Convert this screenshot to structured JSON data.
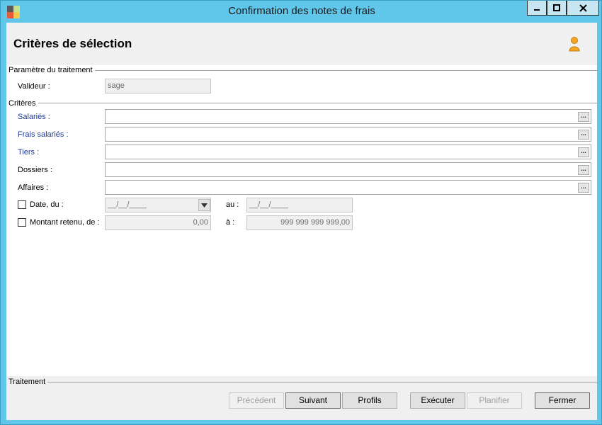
{
  "window": {
    "title": "Confirmation des notes de frais"
  },
  "header": {
    "title": "Critères de sélection"
  },
  "groups": {
    "parametre": "Paramètre du traitement",
    "criteres": "Critères",
    "traitement": "Traitement"
  },
  "fields": {
    "valideur": {
      "label": "Valideur :",
      "value": "sage"
    },
    "salaries": {
      "label": "Salariés :",
      "value": ""
    },
    "frais_salaries": {
      "label": "Frais salariés :",
      "value": ""
    },
    "tiers": {
      "label": "Tiers :",
      "value": ""
    },
    "dossiers": {
      "label": "Dossiers :",
      "value": ""
    },
    "affaires": {
      "label": "Affaires :",
      "value": ""
    },
    "date_du": {
      "label": "Date, du :",
      "value": "__/__/____",
      "checked": false
    },
    "date_au": {
      "label": "au :",
      "value": "__/__/____"
    },
    "montant_de": {
      "label": "Montant retenu, de :",
      "value": "0,00",
      "checked": false
    },
    "montant_a": {
      "label": "à :",
      "value": "999 999 999 999,00"
    }
  },
  "ellipsis_label": "...",
  "buttons": {
    "precedent": "Précédent",
    "suivant": "Suivant",
    "profils": "Profils",
    "executer": "Exécuter",
    "planifier": "Planifier",
    "fermer": "Fermer"
  },
  "colors": {
    "titlebar": "#61c7ea",
    "link_label": "#1f3a93"
  },
  "icons": {
    "app": "app-logo-icon",
    "user": "user-icon",
    "minimize": "minimize-icon",
    "maximize": "maximize-icon",
    "close": "close-icon",
    "dropdown": "chevron-down-icon"
  }
}
